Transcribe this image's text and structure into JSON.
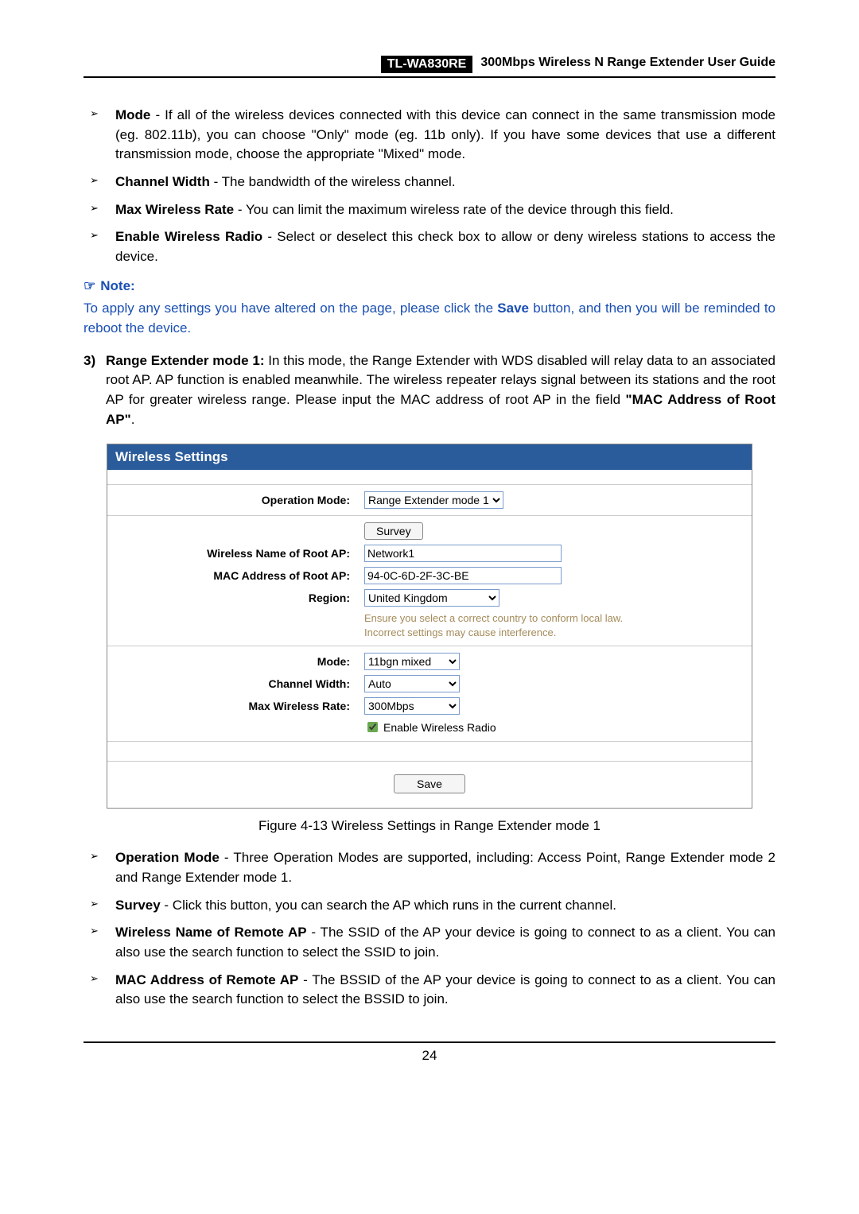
{
  "header": {
    "model": "TL-WA830RE",
    "guide": "300Mbps Wireless N Range Extender User Guide"
  },
  "bullets_top": [
    {
      "label": "Mode",
      "text": " - If all of the wireless devices connected with this device can connect in the same transmission mode (eg. 802.11b), you can choose \"Only\" mode (eg. 11b only). If you have some devices that use a different transmission mode, choose the appropriate \"Mixed\" mode."
    },
    {
      "label": "Channel Width",
      "text": " - The bandwidth of the wireless channel."
    },
    {
      "label": "Max Wireless Rate",
      "text": " - You can limit the maximum wireless rate of the device through this field."
    },
    {
      "label": "Enable Wireless Radio",
      "text": " - Select or deselect this check box to allow or deny wireless stations to access the device."
    }
  ],
  "note": {
    "head": "Note:",
    "body": "To apply any settings you have altered on the page, please click the Save button, and then you will be reminded to reboot the device.",
    "save_word": "Save"
  },
  "step3": {
    "num": "3)",
    "title": "Range Extender mode 1:",
    "body": " In this mode, the Range Extender with WDS disabled will relay data to an associated root AP. AP function is enabled meanwhile. The wireless repeater relays signal between its stations and the root AP for greater wireless range. Please input the MAC address of root AP in the field ",
    "field_ref": "\"MAC Address of Root AP\""
  },
  "settings": {
    "panel_title": "Wireless Settings",
    "labels": {
      "op_mode": "Operation Mode:",
      "wn_root": "Wireless Name of Root AP:",
      "mac_root": "MAC Address of Root AP:",
      "region": "Region:",
      "mode": "Mode:",
      "ch_width": "Channel Width:",
      "max_rate": "Max Wireless Rate:"
    },
    "values": {
      "op_mode": "Range Extender mode 1",
      "survey_btn": "Survey",
      "wn_root": "Network1",
      "mac_root": "94-0C-6D-2F-3C-BE",
      "region": "United Kingdom",
      "hint1": "Ensure you select a correct country to conform local law.",
      "hint2": "Incorrect settings may cause interference.",
      "mode": "11bgn mixed",
      "ch_width": "Auto",
      "max_rate": "300Mbps",
      "enable_radio": "Enable Wireless Radio",
      "save_btn": "Save"
    }
  },
  "caption": "Figure 4-13 Wireless Settings in Range Extender mode 1",
  "bullets_bottom": [
    {
      "label": "Operation Mode",
      "text": " - Three Operation Modes are supported, including: Access Point, Range Extender mode 2 and Range Extender mode 1."
    },
    {
      "label": "Survey",
      "text": " - Click this button, you can search the AP which runs in the current channel."
    },
    {
      "label": "Wireless Name of Remote AP",
      "text": " - The SSID of the AP your device is going to connect to as a client. You can also use the search function to select the SSID to join."
    },
    {
      "label": "MAC Address of Remote AP",
      "text": " - The BSSID of the AP your device is going to connect to as a client. You can also use the search function to select the BSSID to join."
    }
  ],
  "page_number": "24",
  "chart_data": {
    "type": "table",
    "title": "Wireless Settings form values",
    "rows": [
      [
        "Operation Mode",
        "Range Extender mode 1"
      ],
      [
        "Wireless Name of Root AP",
        "Network1"
      ],
      [
        "MAC Address of Root AP",
        "94-0C-6D-2F-3C-BE"
      ],
      [
        "Region",
        "United Kingdom"
      ],
      [
        "Mode",
        "11bgn mixed"
      ],
      [
        "Channel Width",
        "Auto"
      ],
      [
        "Max Wireless Rate",
        "300Mbps"
      ],
      [
        "Enable Wireless Radio",
        "checked"
      ]
    ]
  }
}
